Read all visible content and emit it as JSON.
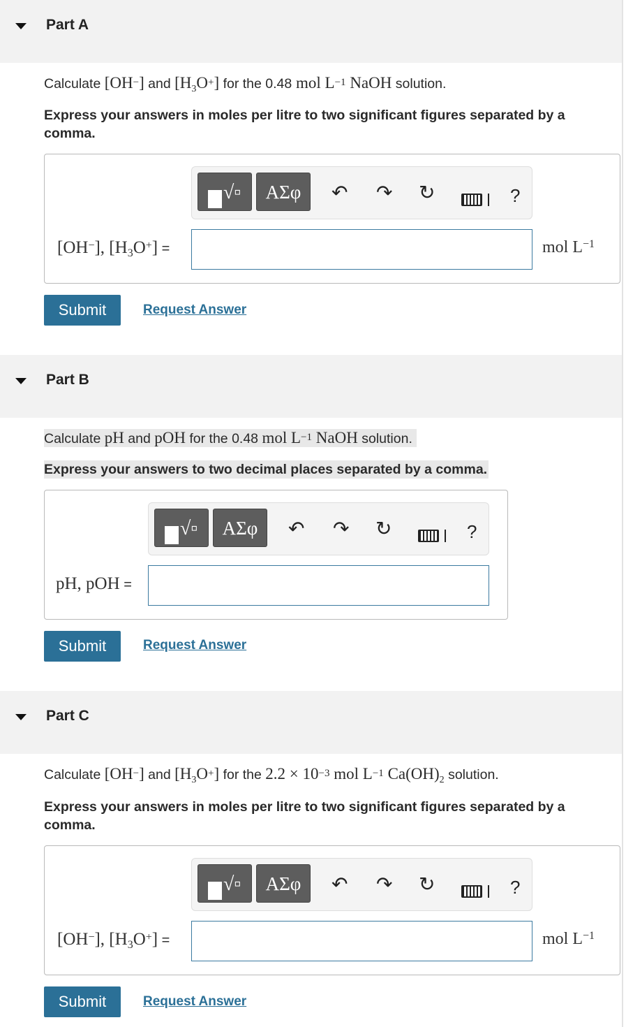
{
  "toolbar": {
    "templates_icon": "fraction-radical-icon",
    "greek_label": "ΑΣφ",
    "undo_icon": "undo-icon",
    "redo_icon": "redo-icon",
    "reset_icon": "reset-icon",
    "keyboard_icon": "keyboard-icon",
    "help_label": "?"
  },
  "parts": {
    "a": {
      "title": "Part A",
      "q_pre": "Calculate ",
      "q_oh": "[OH",
      "q_oh_sup": "−",
      "q_oh_close": "]",
      "q_and": " and ",
      "q_h3o": "[H",
      "q_h3o_sub": "3",
      "q_h3o_o": "O",
      "q_h3o_sup": "+",
      "q_h3o_close": "]",
      "q_for": " for the ",
      "q_conc": "0.48",
      "q_unit": " mol L",
      "q_unit_sup": "−1",
      "q_species": " NaOH",
      "q_post": " solution.",
      "instruction": "Express your answers in moles per litre to two significant figures separated by a comma.",
      "label_oh": "[OH",
      "label_oh_sup": "−",
      "label_mid": "], [H",
      "label_sub": "3",
      "label_o": "O",
      "label_sup": "+",
      "label_close": "]",
      "label_eq": " =",
      "answer_value": "",
      "unit": "mol L",
      "unit_sup": "−1",
      "submit": "Submit",
      "request": "Request Answer"
    },
    "b": {
      "title": "Part B",
      "q_pre": "Calculate ",
      "q_ph": "pH",
      "q_and": " and ",
      "q_poh": "pOH",
      "q_for": " for the 0.48 ",
      "q_unit": "mol L",
      "q_unit_sup": "−1",
      "q_species": " NaOH",
      "q_post": " solution.",
      "instruction": "Express your answers to two decimal places separated by a comma.",
      "label": "pH, pOH",
      "label_eq": " =",
      "answer_value": "",
      "submit": "Submit",
      "request": "Request Answer"
    },
    "c": {
      "title": "Part C",
      "q_pre": "Calculate ",
      "q_oh": "[OH",
      "q_oh_sup": "−",
      "q_oh_close": "]",
      "q_and": " and ",
      "q_h3o": "[H",
      "q_h3o_sub": "3",
      "q_h3o_o": "O",
      "q_h3o_sup": "+",
      "q_h3o_close": "]",
      "q_for": " for the ",
      "q_conc": "2.2 × 10",
      "q_conc_sup": "−3",
      "q_unit": " mol L",
      "q_unit_sup": "−1",
      "q_species": " Ca(OH)",
      "q_species_sub": "2",
      "q_post": " solution.",
      "instruction": "Express your answers in moles per litre to two significant figures separated by a comma.",
      "label_oh": "[OH",
      "label_oh_sup": "−",
      "label_mid": "], [H",
      "label_sub": "3",
      "label_o": "O",
      "label_sup": "+",
      "label_close": "]",
      "label_eq": " =",
      "answer_value": "",
      "unit": "mol L",
      "unit_sup": "−1",
      "submit": "Submit",
      "request": "Request Answer"
    }
  }
}
